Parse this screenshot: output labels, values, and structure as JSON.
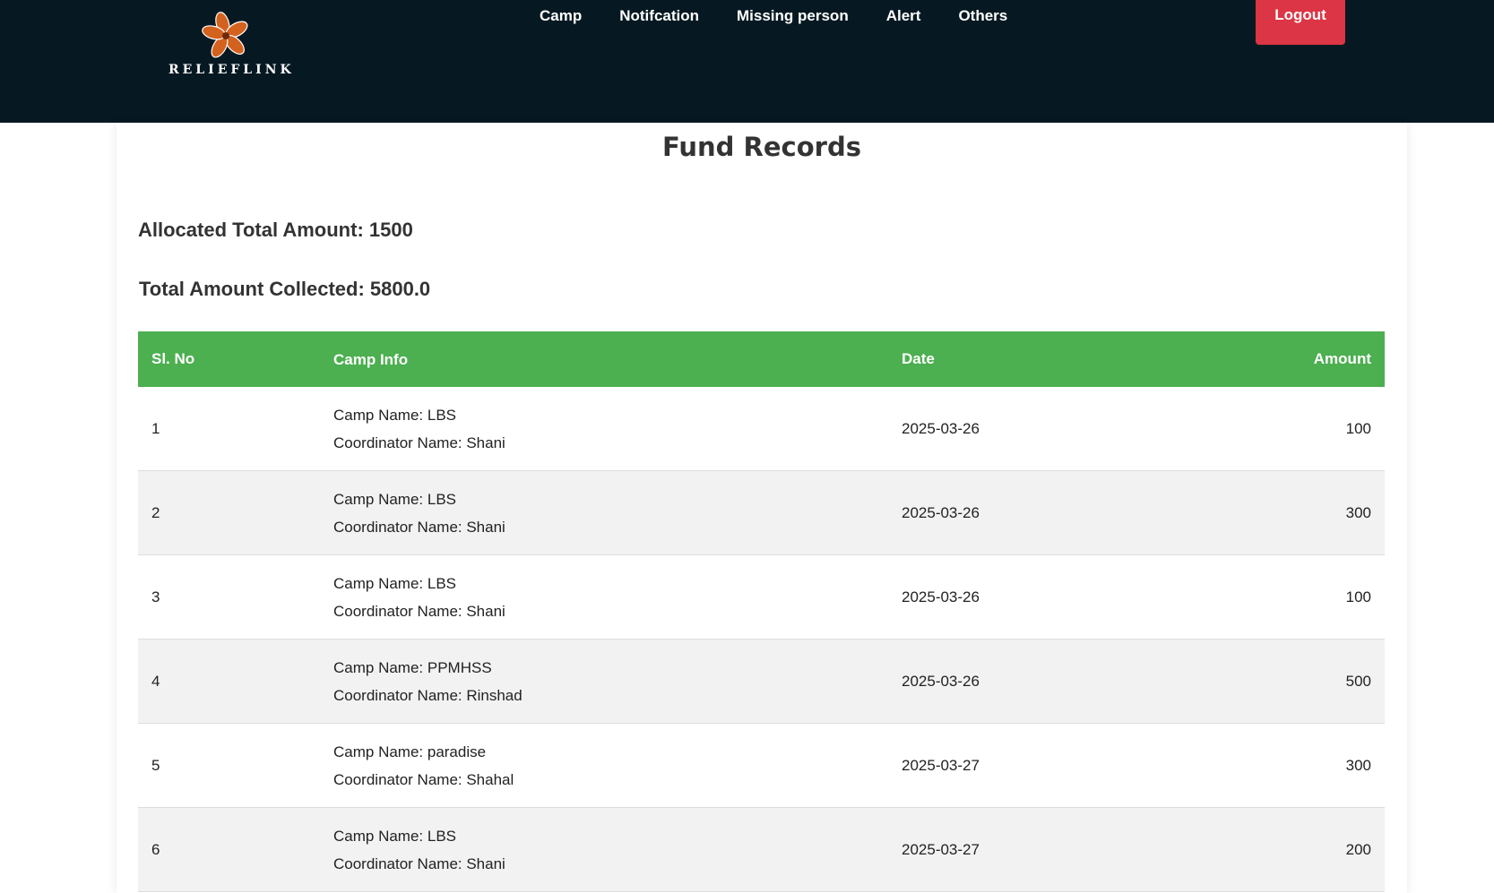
{
  "brand": {
    "name": "RELIEFLINK"
  },
  "nav": {
    "items": [
      "Camp",
      "Notifcation",
      "Missing person",
      "Alert",
      "Others"
    ],
    "logout_label": "Logout"
  },
  "page": {
    "title": "Fund Records",
    "allocated": "Allocated Total Amount: 1500",
    "collected": "Total Amount Collected: 5800.0"
  },
  "table": {
    "headers": [
      "Sl. No",
      "Camp Info",
      "Date",
      "Amount"
    ],
    "rows": [
      {
        "sl": "1",
        "camp": "Camp Name: LBS",
        "coordinator": "Coordinator Name: Shani",
        "date": "2025-03-26",
        "amount": "100"
      },
      {
        "sl": "2",
        "camp": "Camp Name: LBS",
        "coordinator": "Coordinator Name: Shani",
        "date": "2025-03-26",
        "amount": "300"
      },
      {
        "sl": "3",
        "camp": "Camp Name: LBS",
        "coordinator": "Coordinator Name: Shani",
        "date": "2025-03-26",
        "amount": "100"
      },
      {
        "sl": "4",
        "camp": "Camp Name: PPMHSS",
        "coordinator": "Coordinator Name: Rinshad",
        "date": "2025-03-26",
        "amount": "500"
      },
      {
        "sl": "5",
        "camp": "Camp Name: paradise",
        "coordinator": "Coordinator Name: Shahal",
        "date": "2025-03-27",
        "amount": "300"
      },
      {
        "sl": "6",
        "camp": "Camp Name: LBS",
        "coordinator": "Coordinator Name: Shani",
        "date": "2025-03-27",
        "amount": "200"
      }
    ]
  },
  "colors": {
    "navbar_bg": "#061922",
    "header_green": "#4caf50",
    "logout_red": "#dc3545",
    "logo_orange": "#d4621f"
  }
}
